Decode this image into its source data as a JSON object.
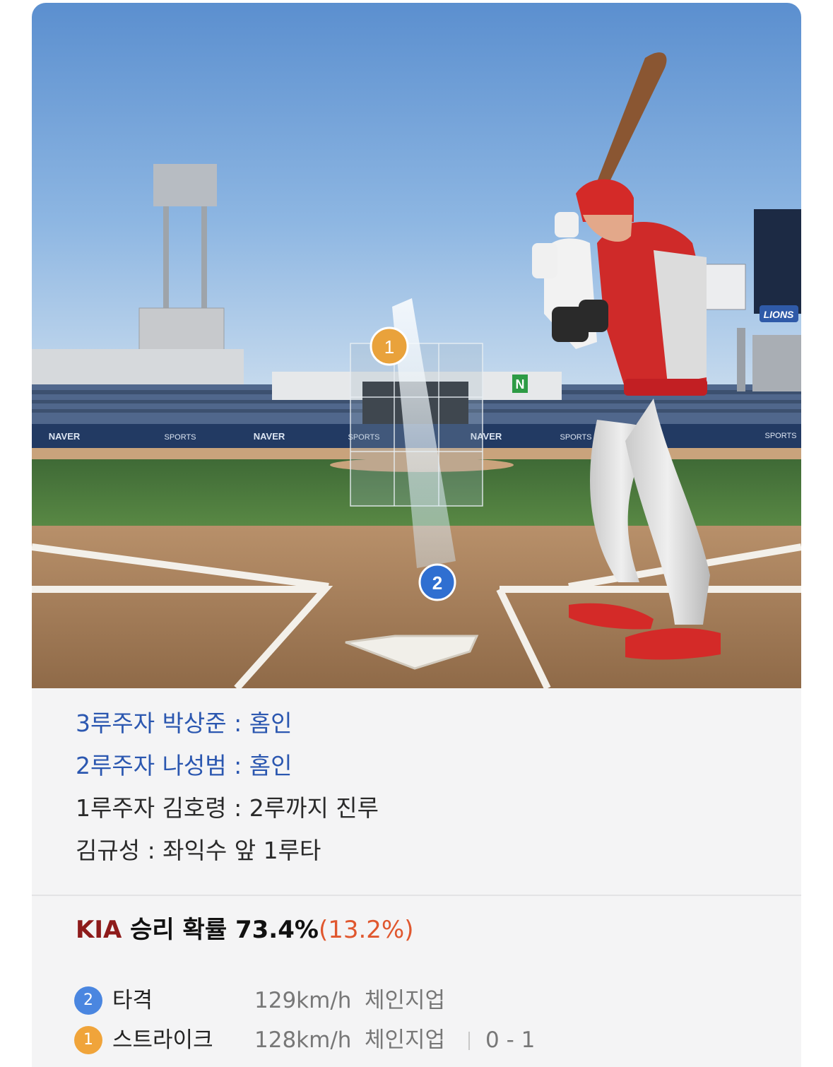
{
  "scene": {
    "ad_boards": [
      "NAVER",
      "SPORTS",
      "NAVER",
      "SPORTS",
      "NAVER",
      "SPORTS",
      "SPORTS"
    ],
    "outfield_sign": "N",
    "scoreboard_logo": "LIONS",
    "pitch_markers": [
      {
        "number": "1",
        "color": "#e9a23b"
      },
      {
        "number": "2",
        "color": "#2f6fd1"
      }
    ]
  },
  "events": [
    {
      "text": "3루주자 박상준 : 홈인",
      "style": "blue"
    },
    {
      "text": "2루주자 나성범 : 홈인",
      "style": "blue"
    },
    {
      "text": "1루주자 김호령 : 2루까지 진루",
      "style": "dark"
    },
    {
      "text": "김규성 : 좌익수 앞 1루타",
      "style": "dark"
    }
  ],
  "win_probability": {
    "team": "KIA",
    "label": "승리 확률",
    "value": "73.4%",
    "delta": "(13.2%)"
  },
  "pitches": [
    {
      "number": "2",
      "result": "타격",
      "speed": "129km/h",
      "type": "체인지업",
      "count": "",
      "color": "#4a86e0"
    },
    {
      "number": "1",
      "result": "스트라이크",
      "speed": "128km/h",
      "type": "체인지업",
      "count": "0 - 1",
      "color": "#f0a43a"
    }
  ],
  "colors": {
    "event_highlight": "#2b57b0",
    "team": "#8e1b1b",
    "delta": "#e0572e"
  }
}
